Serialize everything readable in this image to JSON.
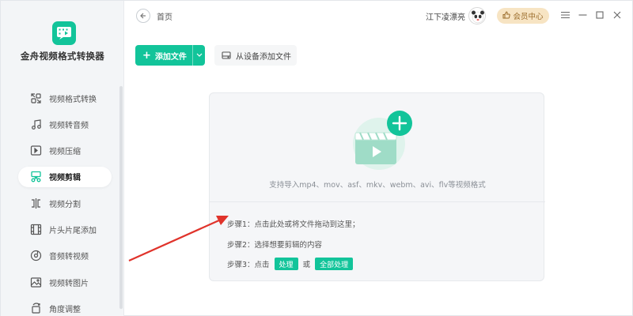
{
  "app": {
    "name": "金舟视频格式转换器"
  },
  "sidebar": {
    "items": [
      {
        "label": "视频格式转换",
        "icon": "convert-icon",
        "active": false
      },
      {
        "label": "视频转音频",
        "icon": "music-note-icon",
        "active": false
      },
      {
        "label": "视频压缩",
        "icon": "compress-icon",
        "active": false
      },
      {
        "label": "视频剪辑",
        "icon": "scissors-icon",
        "active": true
      },
      {
        "label": "视频分割",
        "icon": "split-icon",
        "active": false
      },
      {
        "label": "片头片尾添加",
        "icon": "film-icon",
        "active": false
      },
      {
        "label": "音频转视频",
        "icon": "disc-icon",
        "active": false
      },
      {
        "label": "视频转图片",
        "icon": "image-icon",
        "active": false
      },
      {
        "label": "角度调整",
        "icon": "rotate-icon",
        "active": false
      }
    ]
  },
  "header": {
    "breadcrumb": "首页",
    "username": "江下凌漂亮",
    "vip_label": "会员中心"
  },
  "toolbar": {
    "add_file_label": "添加文件",
    "add_device_label": "从设备添加文件"
  },
  "dropzone": {
    "formats_text": "支持导入mp4、mov、asf、mkv、webm、avi、flv等视频格式",
    "step1": "步骤1：点击此处或将文件拖动到这里；",
    "step2": "步骤2：选择想要剪辑的内容",
    "step3_prefix": "步骤3：点击",
    "step3_btn1": "处理",
    "step3_or": "或",
    "step3_btn2": "全部处理"
  },
  "colors": {
    "accent": "#12c49a",
    "vip_bg": "#f7e4c3",
    "annotation_arrow": "#e0332b"
  }
}
